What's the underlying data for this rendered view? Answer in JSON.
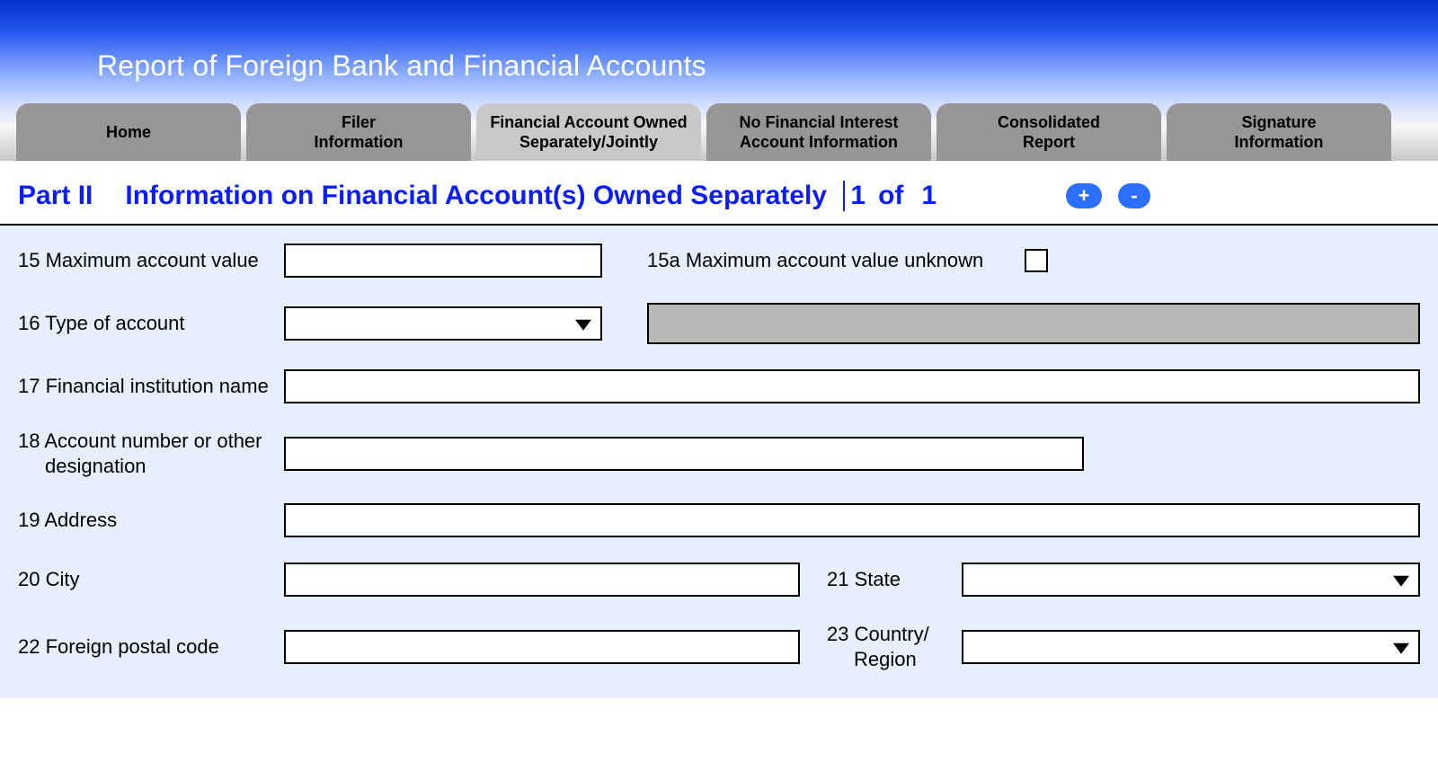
{
  "header": {
    "title": "Report of Foreign Bank and Financial Accounts"
  },
  "tabs": [
    {
      "label": "Home",
      "active": false
    },
    {
      "label": "Filer Information",
      "active": false
    },
    {
      "label": "Financial Account Owned Separately/Jointly",
      "active": true
    },
    {
      "label": "No Financial Interest Account Information",
      "active": false
    },
    {
      "label": "Consolidated Report",
      "active": false
    },
    {
      "label": "Signature Information",
      "active": false
    }
  ],
  "section": {
    "part": "Part II",
    "title": "Information on Financial Account(s) Owned Separately",
    "current": "1",
    "of_word": "of",
    "total": "1",
    "plus": "+",
    "minus": "-"
  },
  "fields": {
    "f15_label": "15 Maximum account value",
    "f15_value": "",
    "f15a_label": "15a Maximum account value unknown",
    "f16_label": "16 Type of account",
    "f16_value": "",
    "f16_other_value": "",
    "f17_label": "17 Financial institution name",
    "f17_value": "",
    "f18_label_line1": "18 Account number or other",
    "f18_label_line2": "designation",
    "f18_value": "",
    "f19_label": "19  Address",
    "f19_value": "",
    "f20_label": "20  City",
    "f20_value": "",
    "f21_label": "21 State",
    "f21_value": "",
    "f22_label": "22 Foreign postal code",
    "f22_value": "",
    "f23_label_line1": "23 Country/",
    "f23_label_line2": "Region",
    "f23_value": ""
  }
}
